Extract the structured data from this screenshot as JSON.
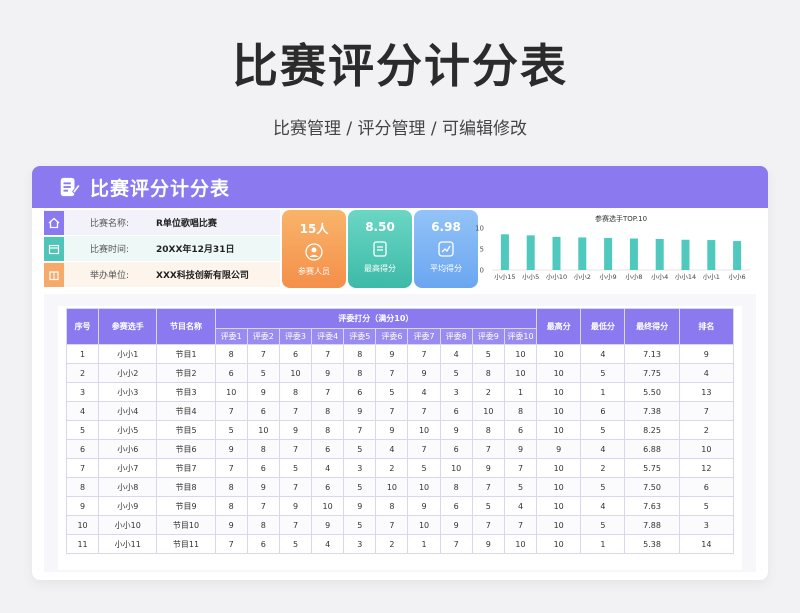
{
  "page": {
    "title": "比赛评分计分表",
    "subtitle": "比赛管理 / 评分管理 / 可编辑修改"
  },
  "card": {
    "title": "比赛评分计分表",
    "info": [
      {
        "label": "比赛名称:",
        "value": "R单位歌唱比赛",
        "icon": "home-icon",
        "color": "#8a79ef"
      },
      {
        "label": "比赛时间:",
        "value": "20XX年12月31日",
        "icon": "calendar-icon",
        "color": "#4fc4b8"
      },
      {
        "label": "举办单位:",
        "value": "XXX科技创新有限公司",
        "icon": "building-icon",
        "color": "#f5a96a"
      }
    ],
    "stats": [
      {
        "value": "15人",
        "label": "参赛人员",
        "icon": "people-icon",
        "color": "#f7a25c"
      },
      {
        "value": "8.50",
        "label": "最高得分",
        "icon": "document-icon",
        "color": "#54c9b6"
      },
      {
        "value": "6.98",
        "label": "平均得分",
        "icon": "trend-icon",
        "color": "#7fb6f5"
      }
    ]
  },
  "chart_data": {
    "type": "bar",
    "title": "参赛选手TOP.10",
    "categories": [
      "小小15",
      "小小5",
      "小小10",
      "小小2",
      "小小9",
      "小小8",
      "小小4",
      "小小14",
      "小小1",
      "小小6"
    ],
    "values": [
      8.5,
      8.25,
      7.88,
      7.75,
      7.63,
      7.5,
      7.38,
      7.2,
      7.13,
      6.88
    ],
    "ylim": [
      0,
      10
    ],
    "yticks": [
      "10",
      "5",
      "0"
    ],
    "bar_color": "#4fc8bd"
  },
  "table": {
    "headers": {
      "index": "序号",
      "contestant": "参赛选手",
      "program": "节目名称",
      "judges_group": "评委打分（满分10）",
      "judges": [
        "评委1",
        "评委2",
        "评委3",
        "评委4",
        "评委5",
        "评委6",
        "评委7",
        "评委8",
        "评委9",
        "评委10"
      ],
      "max": "最高分",
      "min": "最低分",
      "final": "最终得分",
      "rank": "排名"
    },
    "rows": [
      [
        "1",
        "小小1",
        "节目1",
        "8",
        "7",
        "6",
        "7",
        "8",
        "9",
        "7",
        "4",
        "5",
        "10",
        "10",
        "4",
        "7.13",
        "9"
      ],
      [
        "2",
        "小小2",
        "节目2",
        "6",
        "5",
        "10",
        "9",
        "8",
        "7",
        "9",
        "5",
        "8",
        "10",
        "10",
        "5",
        "7.75",
        "4"
      ],
      [
        "3",
        "小小3",
        "节目3",
        "10",
        "9",
        "8",
        "7",
        "6",
        "5",
        "4",
        "3",
        "2",
        "1",
        "10",
        "1",
        "5.50",
        "13"
      ],
      [
        "4",
        "小小4",
        "节目4",
        "7",
        "6",
        "7",
        "8",
        "9",
        "7",
        "7",
        "6",
        "10",
        "8",
        "10",
        "6",
        "7.38",
        "7"
      ],
      [
        "5",
        "小小5",
        "节目5",
        "5",
        "10",
        "9",
        "8",
        "7",
        "9",
        "10",
        "9",
        "8",
        "6",
        "10",
        "5",
        "8.25",
        "2"
      ],
      [
        "6",
        "小小6",
        "节目6",
        "9",
        "8",
        "7",
        "6",
        "5",
        "4",
        "7",
        "6",
        "7",
        "9",
        "9",
        "4",
        "6.88",
        "10"
      ],
      [
        "7",
        "小小7",
        "节目7",
        "7",
        "6",
        "5",
        "4",
        "3",
        "2",
        "5",
        "10",
        "9",
        "7",
        "10",
        "2",
        "5.75",
        "12"
      ],
      [
        "8",
        "小小8",
        "节目8",
        "8",
        "9",
        "7",
        "6",
        "5",
        "10",
        "10",
        "8",
        "7",
        "5",
        "10",
        "5",
        "7.50",
        "6"
      ],
      [
        "9",
        "小小9",
        "节目9",
        "8",
        "7",
        "9",
        "10",
        "9",
        "8",
        "9",
        "6",
        "5",
        "4",
        "10",
        "4",
        "7.63",
        "5"
      ],
      [
        "10",
        "小小10",
        "节目10",
        "9",
        "8",
        "7",
        "9",
        "5",
        "7",
        "10",
        "9",
        "7",
        "7",
        "10",
        "5",
        "7.88",
        "3"
      ],
      [
        "11",
        "小小11",
        "节目11",
        "7",
        "6",
        "5",
        "4",
        "3",
        "2",
        "1",
        "7",
        "9",
        "10",
        "10",
        "1",
        "5.38",
        "14"
      ]
    ]
  }
}
